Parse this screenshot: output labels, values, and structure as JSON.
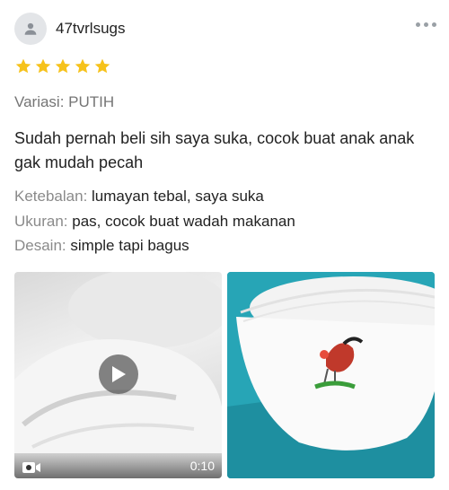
{
  "user": {
    "name": "47tvrlsugs",
    "avatar_icon": "person-icon"
  },
  "rating": {
    "stars": 5,
    "max": 5,
    "color": "#f6c21b"
  },
  "variation": "Variasi: PUTIH",
  "review_text": "Sudah pernah beli sih saya suka, cocok buat anak anak gak mudah pecah",
  "attributes": [
    {
      "key": "Ketebalan:",
      "value": "lumayan tebal, saya suka"
    },
    {
      "key": "Ukuran:",
      "value": "pas, cocok buat wadah makanan"
    },
    {
      "key": "Desain:",
      "value": "simple tapi bagus"
    }
  ],
  "media": {
    "video": {
      "duration": "0:10",
      "icon": "video-camera-icon"
    },
    "photo": {
      "description_icon": "bowl-rooster-photo"
    }
  }
}
